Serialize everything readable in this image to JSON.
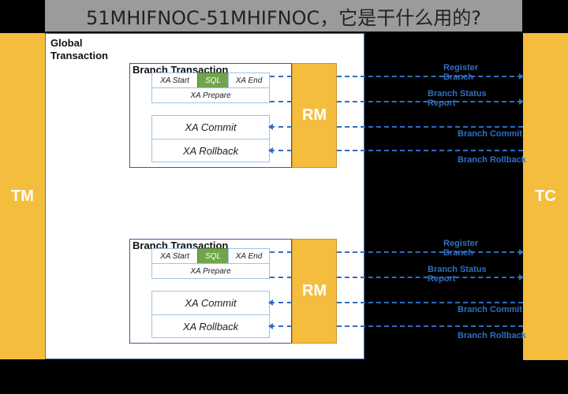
{
  "title": "51MHIFNOC-51MHIFNOC，它是干什么用的?",
  "tm_label": "TM",
  "tc_label": "TC",
  "global_label": "Global Transaction",
  "colors": {
    "bar": "#f5bd3e",
    "sql": "#70a64a",
    "arrow": "#2f6fc0"
  },
  "branches": [
    {
      "label": "Branch Transaction",
      "xa_start": "XA Start",
      "sql": "SQL",
      "xa_end": "XA End",
      "xa_prepare": "XA Prepare",
      "xa_commit": "XA Commit",
      "xa_rollback": "XA Rollback",
      "rm": "RM",
      "register": "Register Branch",
      "status": "Branch Status Report",
      "commit": "Branch Commit",
      "rollback": "Branch Rollback"
    },
    {
      "label": "Branch Transaction",
      "xa_start": "XA Start",
      "sql": "SQL",
      "xa_end": "XA End",
      "xa_prepare": "XA Prepare",
      "xa_commit": "XA Commit",
      "xa_rollback": "XA Rollback",
      "rm": "RM",
      "register": "Register Branch",
      "status": "Branch Status Report",
      "commit": "Branch Commit",
      "rollback": "Branch Rollback"
    }
  ]
}
